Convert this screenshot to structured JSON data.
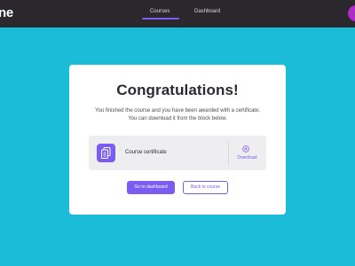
{
  "header": {
    "logo_text": "ne",
    "tabs": [
      {
        "label": "Courses",
        "active": true
      },
      {
        "label": "Dashboard",
        "active": false
      }
    ]
  },
  "colors": {
    "page_background": "#1bbcd8",
    "topbar": "#2b282d",
    "accent": "#7b5cf0",
    "avatar": "#b02cc7"
  },
  "card": {
    "title": "Congratulations!",
    "description_line1": "You finished the course and you have been awarded with a certificate.",
    "description_line2": "You can download it from the block below.",
    "certificate": {
      "icon": "certificate-document-icon",
      "label": "Course certificate",
      "download_icon": "download-plus-icon",
      "download_label": "Download"
    },
    "buttons": {
      "primary": "Go to dashboard",
      "secondary": "Back to course"
    }
  }
}
